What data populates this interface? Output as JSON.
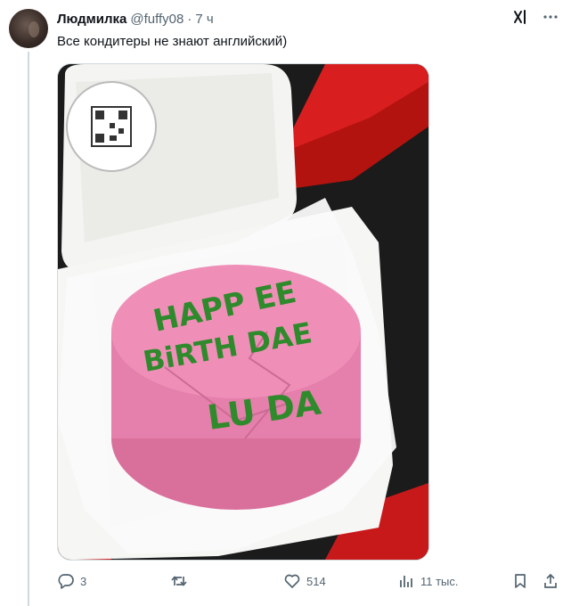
{
  "post": {
    "author_name": "Людмилка",
    "author_handle": "@fuffy08",
    "separator": "·",
    "time": "7 ч",
    "text": "Все кондитеры не знают английский)"
  },
  "media": {
    "cake_text": [
      "HAPP EE",
      "BiRTH DAE",
      "LU DA"
    ],
    "colors": {
      "cake": "#ef8fb8",
      "icing_text": "#2f8a2c",
      "ribbon": "#d81e1e",
      "box": "#f4f4f2"
    }
  },
  "actions": {
    "reply_count": "3",
    "retweet_count": "",
    "like_count": "514",
    "views_count": "11 тыс."
  },
  "icons": [
    "grok-icon",
    "more-icon",
    "reply-icon",
    "retweet-icon",
    "like-icon",
    "views-icon",
    "bookmark-icon",
    "share-icon"
  ],
  "theme": {
    "text": "#0f1419",
    "secondary": "#536471",
    "border": "#cfd9de"
  }
}
